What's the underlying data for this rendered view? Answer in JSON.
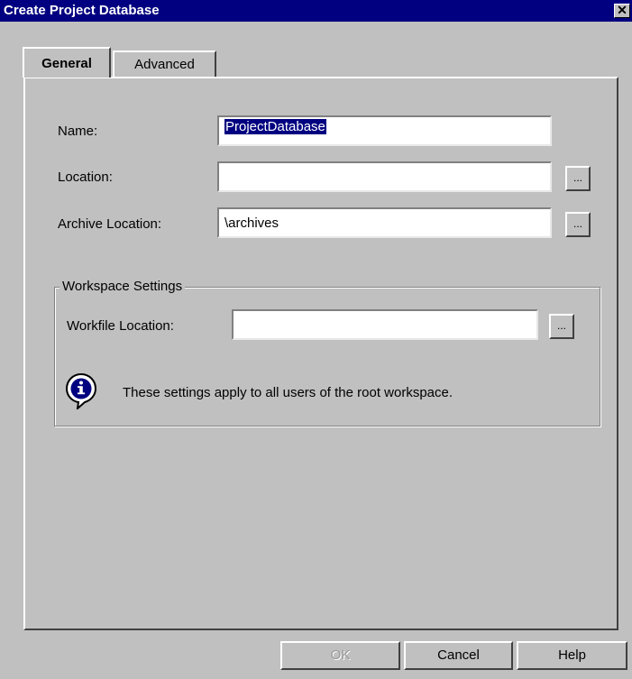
{
  "window": {
    "title": "Create Project Database",
    "close_symbol": "✕"
  },
  "tabs": [
    {
      "label": "General",
      "active": true
    },
    {
      "label": "Advanced",
      "active": false
    }
  ],
  "form": {
    "name_label": "Name:",
    "name_value": "ProjectDatabase",
    "location_label": "Location:",
    "location_value": "",
    "archive_label": "Archive Location:",
    "archive_value": "\\archives",
    "browse_label": "..."
  },
  "workspace": {
    "group_title": "Workspace Settings",
    "workfile_label": "Workfile Location:",
    "workfile_value": "",
    "info_icon": "info-balloon-icon",
    "info_text": "These settings apply to all users of the root workspace."
  },
  "buttons": {
    "ok": "OK",
    "ok_enabled": false,
    "cancel": "Cancel",
    "help": "Help"
  }
}
